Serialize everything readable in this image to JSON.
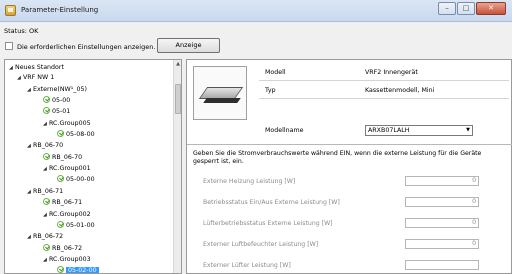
{
  "window": {
    "title": "Parameter-Einstellung",
    "minimize": "–",
    "maximize": "□",
    "close": "✕"
  },
  "status": "Status: OK",
  "show_required_label": "Die erforderlichen Einstellungen anzeigen.",
  "show_button": "Anzeige",
  "tree": {
    "root": "Neues Standort",
    "vrf": "VRF NW 1",
    "extern": "Externe(NW¹_05)",
    "n0500": "05-00",
    "n0501": "05-01",
    "rc005": "RC.Group005",
    "n050800": "05-08-00",
    "rb70": "RB_06-70",
    "rb70b": "RB_06-70",
    "rc001": "RC.Group001",
    "n050000": "05-00-00",
    "rb71": "RB_06-71",
    "rb71b": "RB_06-71",
    "rc002": "RC.Group002",
    "n050100": "05-01-00",
    "rb72": "RB_06-72",
    "rb72b": "RB_06-72",
    "rc003": "RC.Group003",
    "n050200": "05-02-00"
  },
  "device": {
    "model_label": "Modell",
    "model_value": "VRF2 Innengerät",
    "type_label": "Typ",
    "type_value": "Kassettenmodell, Mini",
    "name_label": "Modellname",
    "name_value": "ARXB07LALH"
  },
  "description": "Geben Sie die Stromverbrauchswerte während EIN, wenn die externe Leistung für die Geräte gesperrt ist, ein.",
  "fields": [
    {
      "label": "Externe Heizung Leistung [W]",
      "value": "0"
    },
    {
      "label": "Betriebsstatus Ein/Aus Externe Leistung [W]",
      "value": "0"
    },
    {
      "label": "Lüfterbetriebsstatus Externe Leistung [W]",
      "value": "0"
    },
    {
      "label": "Externer Luftbefeuchter Leistung [W]",
      "value": "0"
    },
    {
      "label": "Externer Lüfter Leistung [W]",
      "value": ""
    }
  ]
}
